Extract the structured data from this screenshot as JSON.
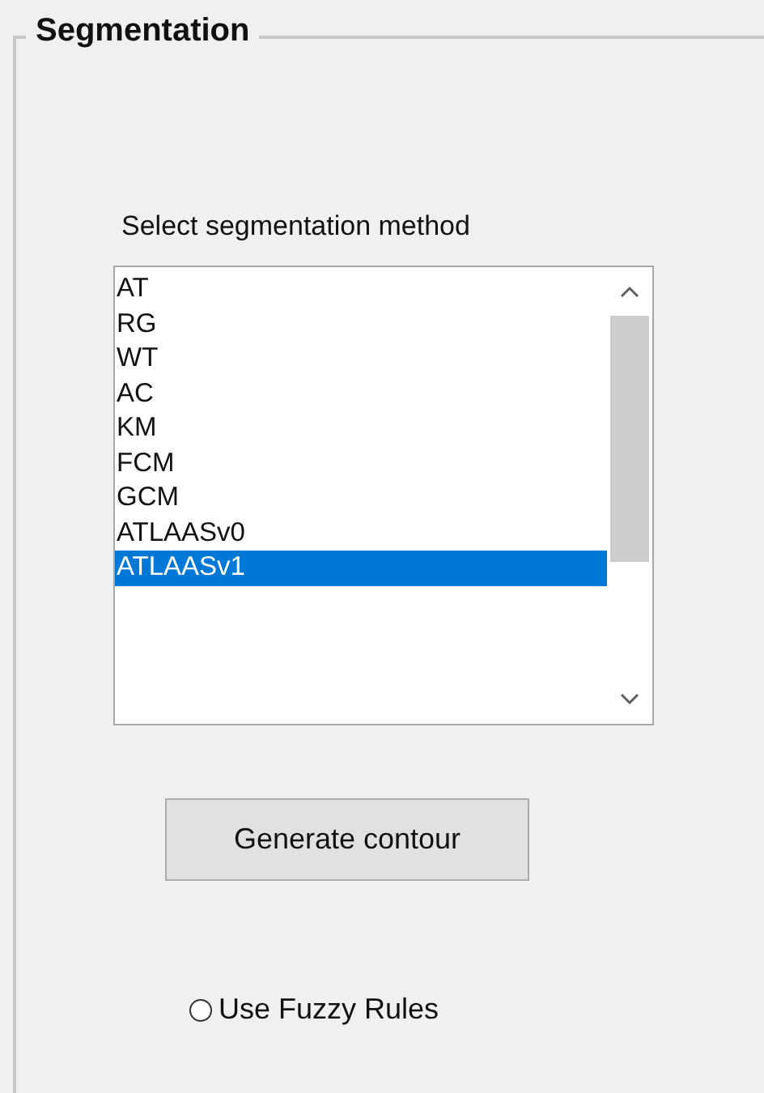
{
  "panel": {
    "title": "Segmentation"
  },
  "method_label": "Select segmentation method",
  "method_list": {
    "items": [
      {
        "label": "AT",
        "selected": false
      },
      {
        "label": "RG",
        "selected": false
      },
      {
        "label": "WT",
        "selected": false
      },
      {
        "label": "AC",
        "selected": false
      },
      {
        "label": "KM",
        "selected": false
      },
      {
        "label": "FCM",
        "selected": false
      },
      {
        "label": "GCM",
        "selected": false
      },
      {
        "label": "ATLAASv0",
        "selected": false
      },
      {
        "label": "ATLAASv1",
        "selected": true
      }
    ]
  },
  "generate_button": "Generate contour",
  "fuzzy_radio": {
    "label": "Use Fuzzy Rules",
    "selected": false
  }
}
